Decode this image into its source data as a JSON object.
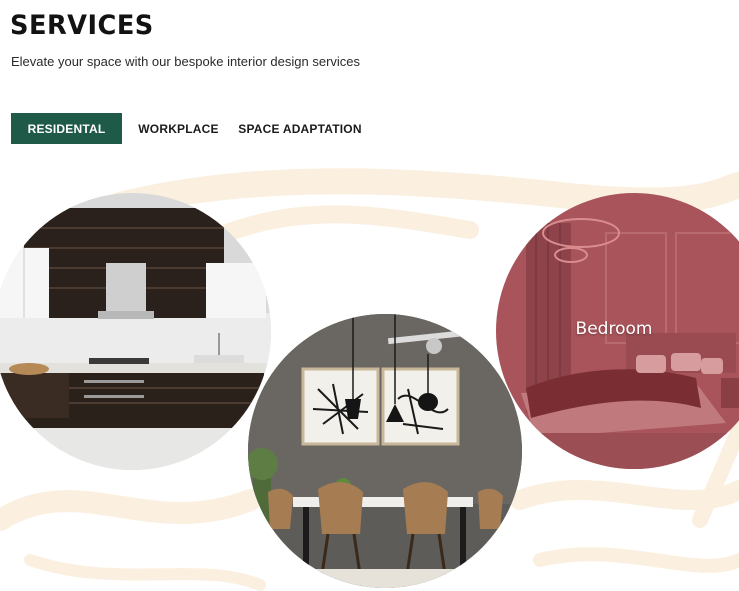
{
  "header": {
    "title": "SERVICES",
    "subtitle": "Elevate your space with our bespoke interior design services"
  },
  "tabs": [
    {
      "label": "RESIDENTAL",
      "active": true
    },
    {
      "label": "WORKPLACE",
      "active": false
    },
    {
      "label": "SPACE ADAPTATION",
      "active": false
    }
  ],
  "services": [
    {
      "name": "kitchen",
      "label": ""
    },
    {
      "name": "dining",
      "label": ""
    },
    {
      "name": "bedroom",
      "label": "Bedroom",
      "overlay_color": "#a8545a"
    }
  ],
  "colors": {
    "accent": "#1f5a48",
    "swirl": "#fbefdf",
    "bedroom_overlay": "#a8545a"
  }
}
